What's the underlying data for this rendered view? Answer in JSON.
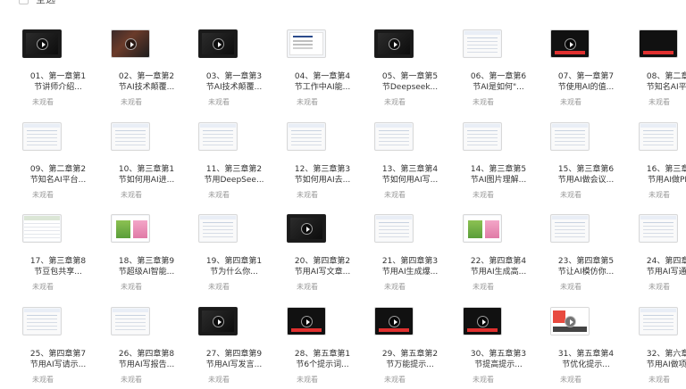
{
  "header": {
    "select_all_label": "全选"
  },
  "status_label": "未观看",
  "videos": [
    {
      "l1": "01、第一章第1",
      "l2": "节讲师介绍...",
      "thumb": "dark",
      "play": true
    },
    {
      "l1": "02、第一章第2",
      "l2": "节AI技术颠覆...",
      "thumb": "photo",
      "play": true
    },
    {
      "l1": "03、第一章第3",
      "l2": "节AI技术颠覆...",
      "thumb": "dark",
      "play": true
    },
    {
      "l1": "04、第一章第4",
      "l2": "节工作中AI能...",
      "thumb": "slide",
      "play": false
    },
    {
      "l1": "05、第一章第5",
      "l2": "节Deepseek...",
      "thumb": "dark",
      "play": true
    },
    {
      "l1": "06、第一章第6",
      "l2": "节AI是如何\"...",
      "thumb": "web",
      "play": false
    },
    {
      "l1": "07、第一章第7",
      "l2": "节使用AI的值...",
      "thumb": "banner",
      "play": true
    },
    {
      "l1": "08、第二章第1",
      "l2": "节知名AI平台...",
      "thumb": "banner",
      "play": false
    },
    {
      "l1": "09、第二章第2",
      "l2": "节知名AI平台...",
      "thumb": "web",
      "play": false
    },
    {
      "l1": "10、第三章第1",
      "l2": "节如何用AI进...",
      "thumb": "web",
      "play": false
    },
    {
      "l1": "11、第三章第2",
      "l2": "节用DeepSee...",
      "thumb": "web",
      "play": false
    },
    {
      "l1": "12、第三章第3",
      "l2": "节如何用AI去...",
      "thumb": "web",
      "play": false
    },
    {
      "l1": "13、第三章第4",
      "l2": "节如何用AI写...",
      "thumb": "web",
      "play": false
    },
    {
      "l1": "14、第三章第5",
      "l2": "节AI图片理解...",
      "thumb": "web",
      "play": false
    },
    {
      "l1": "15、第三章第6",
      "l2": "节用AI做会议...",
      "thumb": "web",
      "play": false
    },
    {
      "l1": "16、第三章第7",
      "l2": "节用AI做PPT...",
      "thumb": "web",
      "play": false
    },
    {
      "l1": "17、第三章第8",
      "l2": "节豆包共享...",
      "thumb": "sheet",
      "play": false
    },
    {
      "l1": "18、第三章第9",
      "l2": "节超级AI智能...",
      "thumb": "colorful",
      "play": false
    },
    {
      "l1": "19、第四章第1",
      "l2": "节为什么你...",
      "thumb": "web",
      "play": false
    },
    {
      "l1": "20、第四章第2",
      "l2": "节用AI写文章...",
      "thumb": "dark",
      "play": true
    },
    {
      "l1": "21、第四章第3",
      "l2": "节用AI生成爆...",
      "thumb": "web",
      "play": false
    },
    {
      "l1": "22、第四章第4",
      "l2": "节用AI生成高...",
      "thumb": "colorful",
      "play": false
    },
    {
      "l1": "23、第四章第5",
      "l2": "节让AI模仿你...",
      "thumb": "web",
      "play": false
    },
    {
      "l1": "24、第四章第6",
      "l2": "节用AI写通知...",
      "thumb": "web",
      "play": false
    },
    {
      "l1": "25、第四章第7",
      "l2": "节用AI写请示...",
      "thumb": "web",
      "play": false
    },
    {
      "l1": "26、第四章第8",
      "l2": "节用AI写报告...",
      "thumb": "web",
      "play": false
    },
    {
      "l1": "27、第四章第9",
      "l2": "节用AI写发言...",
      "thumb": "dark",
      "play": true
    },
    {
      "l1": "28、第五章第1",
      "l2": "节6个提示词...",
      "thumb": "banner",
      "play": true
    },
    {
      "l1": "29、第五章第2",
      "l2": "节万能提示...",
      "thumb": "banner",
      "play": true
    },
    {
      "l1": "30、第五章第3",
      "l2": "节提高提示...",
      "thumb": "banner",
      "play": true
    },
    {
      "l1": "31、第五章第4",
      "l2": "节优化提示...",
      "thumb": "flash",
      "play": true
    },
    {
      "l1": "32、第六章第1",
      "l2": "节用AI做项目...",
      "thumb": "web",
      "play": false
    }
  ]
}
